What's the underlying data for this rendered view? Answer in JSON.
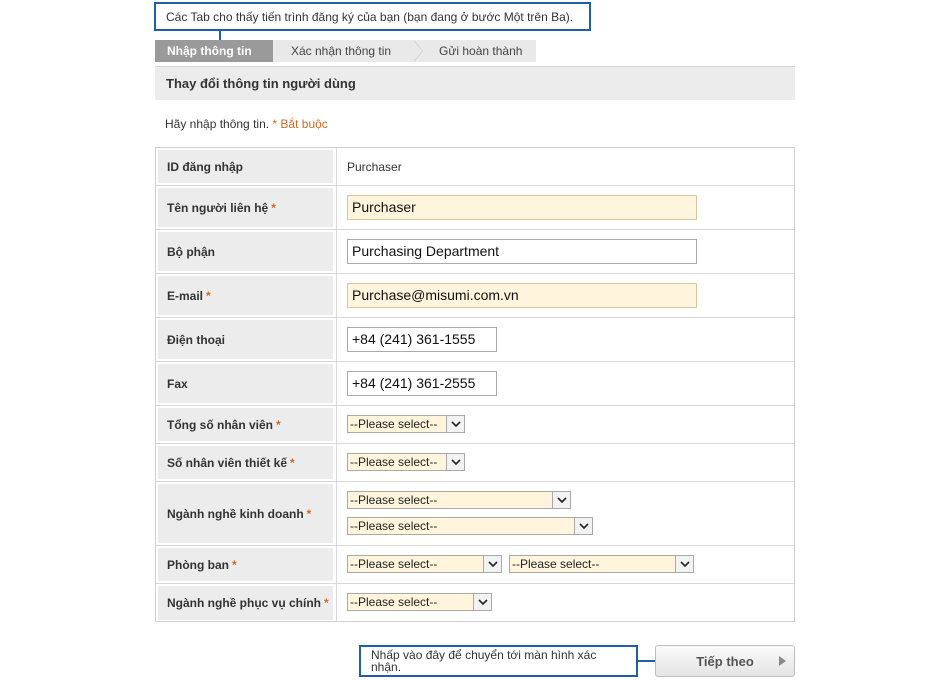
{
  "callouts": {
    "tabs_hint": "Các Tab cho thấy tiến trình đăng ký của bạn (bạn đang ở bước Một trên Ba).",
    "next_hint": "Nhấp vào đây để chuyển tới màn hình xác nhận."
  },
  "steps": [
    {
      "label": "Nhập thông tin",
      "active": true
    },
    {
      "label": "Xác nhận thông tin",
      "active": false
    },
    {
      "label": "Gửi hoàn thành",
      "active": false
    }
  ],
  "page_title": "Thay đổi thông tin người dùng",
  "instruction": {
    "text": "Hãy nhập thông tin.",
    "required_note": "* Bắt buộc"
  },
  "required_mark": "*",
  "fields": {
    "login_id": {
      "label": "ID đăng nhập",
      "value": "Purchaser"
    },
    "contact_name": {
      "label": "Tên người liên hệ",
      "value": "Purchaser"
    },
    "department": {
      "label": "Bộ phận",
      "value": "Purchasing Department"
    },
    "email": {
      "label": "E-mail",
      "value": "Purchase@misumi.com.vn"
    },
    "phone": {
      "label": "Điện thoại",
      "value": "+84 (241) 361-1555"
    },
    "fax": {
      "label": "Fax",
      "value": "+84 (241) 361-2555"
    },
    "total_employees": {
      "label": "Tổng số nhân viên",
      "value": "--Please select--"
    },
    "design_employees": {
      "label": "Số nhân viên thiết kế",
      "value": "--Please select--"
    },
    "business_industry": {
      "label": "Ngành nghề kinh doanh",
      "value_1": "--Please select--",
      "value_2": "--Please select--"
    },
    "division": {
      "label": "Phòng ban",
      "value_1": "--Please select--",
      "value_2": "--Please select--"
    },
    "served_industry": {
      "label": "Ngành nghề phục vụ chính",
      "value": "--Please select--"
    }
  },
  "next_button": {
    "label": "Tiếp theo"
  },
  "colors": {
    "callout_border": "#1f5fa8",
    "required": "#d2691e",
    "highlight_field": "#fff5dc"
  }
}
